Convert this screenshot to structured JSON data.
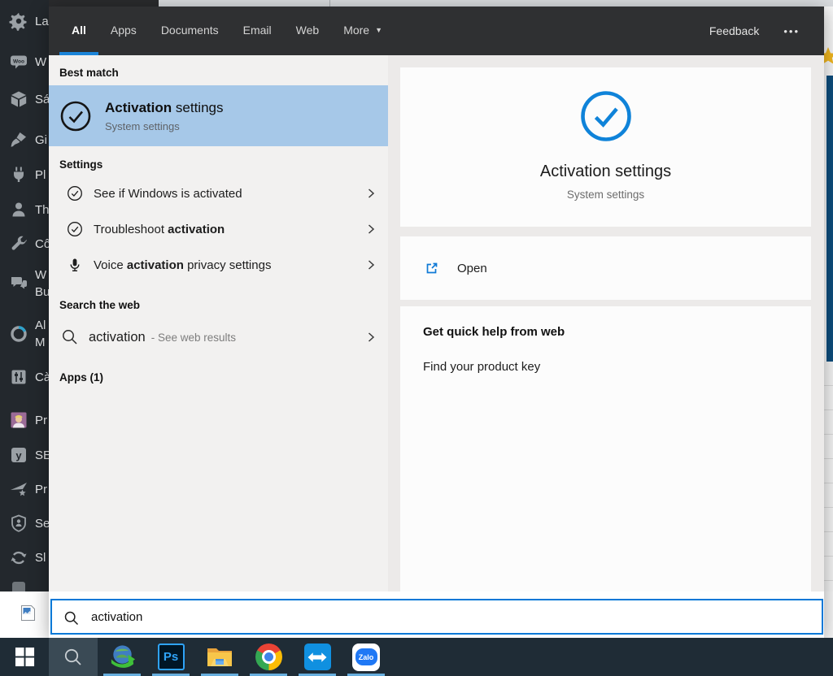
{
  "background": {
    "wp_sidebar": {
      "items": [
        {
          "icon": "gear-icon",
          "label": "La"
        },
        {
          "icon": "woocommerce-icon",
          "label": "W"
        },
        {
          "icon": "products-box-icon",
          "label": "Sá"
        },
        {
          "icon": "appearance-brush-icon",
          "label": "Gi"
        },
        {
          "icon": "plugins-plug-icon",
          "label": "Pl"
        },
        {
          "icon": "users-person-icon",
          "label": "Th"
        },
        {
          "icon": "tools-wrench-icon",
          "label": "Cô"
        },
        {
          "icon": "chat-bubbles-icon",
          "label": "W\nBu"
        },
        {
          "icon": "migration-circle-icon",
          "label": "Al\nM"
        },
        {
          "icon": "settings-sliders-icon",
          "label": "Cà"
        },
        {
          "icon": "profile-avatar-icon",
          "label": "Pr"
        },
        {
          "icon": "yoast-seo-icon",
          "label": "SE"
        },
        {
          "icon": "rocket-star-icon",
          "label": "Pr"
        },
        {
          "icon": "security-shield-icon",
          "label": "Se"
        },
        {
          "icon": "slider-refresh-icon",
          "label": "Sl"
        }
      ]
    }
  },
  "search_panel": {
    "tabs": [
      {
        "label": "All"
      },
      {
        "label": "Apps"
      },
      {
        "label": "Documents"
      },
      {
        "label": "Email"
      },
      {
        "label": "Web"
      }
    ],
    "more_tab": {
      "label": "More",
      "caret": "▼"
    },
    "feedback_label": "Feedback",
    "overflow_menu": "•••",
    "results": {
      "best_match_header": "Best match",
      "best_match": {
        "title_strong": "Activation",
        "title_rest": " settings",
        "subtitle": "System settings"
      },
      "settings_header": "Settings",
      "settings_items": [
        {
          "pre": "See if Windows is activated",
          "strong": "",
          "post": ""
        },
        {
          "pre": "Troubleshoot ",
          "strong": "activation",
          "post": ""
        },
        {
          "pre": "Voice ",
          "strong": "activation",
          "post": " privacy settings"
        }
      ],
      "web_header": "Search the web",
      "web_item": {
        "query": "activation",
        "suffix": "- See web results"
      },
      "apps_header": "Apps (1)"
    },
    "preview": {
      "title": "Activation settings",
      "subtitle": "System settings",
      "open_label": "Open",
      "help_header": "Get quick help from web",
      "help_link": "Find your product key"
    },
    "searchbox": {
      "value": "activation"
    }
  },
  "taskbar": {
    "photoshop_label": "Ps",
    "zalo_label": "Zalo"
  },
  "colors": {
    "accent": "#0078d7",
    "best_match_highlight": "#a6c8e8",
    "header_dark": "#2f3032",
    "taskbar_dark": "#1f2c36",
    "wp_sidebar_dark": "#23282d"
  }
}
